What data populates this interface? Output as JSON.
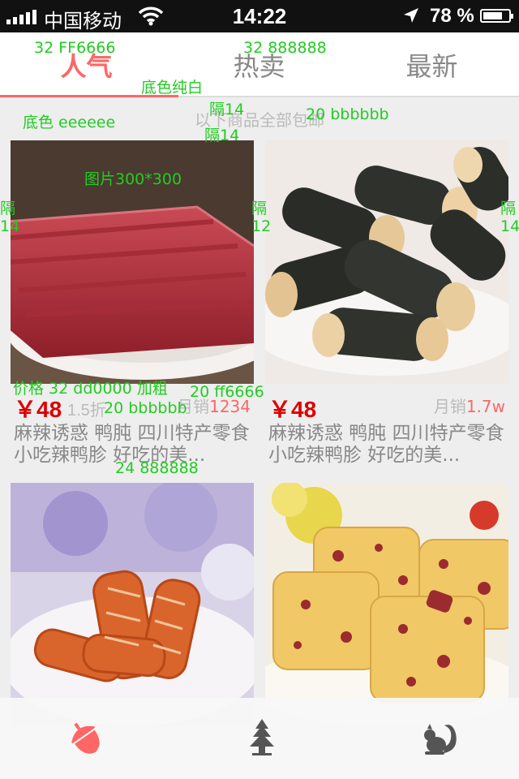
{
  "status": {
    "carrier": "中国移动",
    "time": "14:22",
    "battery": "78 %",
    "battery_level": 0.78
  },
  "tabs": [
    {
      "label": "人气",
      "active": true
    },
    {
      "label": "热卖",
      "active": false
    },
    {
      "label": "最新",
      "active": false
    }
  ],
  "notice": "以下商品全部包邮",
  "products": [
    {
      "price": "￥48",
      "discount": "1.5折",
      "sales_prefix": "月销",
      "sales_value": "1234",
      "title": "麻辣诱惑 鸭肫 四川特产零食小吃辣鸭胗 好吃的美..."
    },
    {
      "price": "￥48",
      "discount": "",
      "sales_prefix": "月销",
      "sales_value": "1.7w",
      "title": "麻辣诱惑 鸭肫 四川特产零食小吃辣鸭胗 好吃的美..."
    },
    {
      "price": "",
      "discount": "",
      "sales_prefix": "",
      "sales_value": "",
      "title": ""
    },
    {
      "price": "",
      "discount": "",
      "sales_prefix": "",
      "sales_value": "",
      "title": ""
    }
  ],
  "annotations": {
    "tab_active": "32 FF6666",
    "tab_inactive": "32 888888",
    "tab_bg": "底色纯白",
    "gap_top": "隔14",
    "page_bg": "底色 eeeeee",
    "notice_spec": "20 bbbbbb",
    "gap_bottom": "隔14",
    "image_spec": "图片300*300",
    "gap_left": "隔\n14",
    "gap_middle": "隔\n12",
    "gap_right": "隔\n14",
    "price_spec": "价格 32 dd0000 加粗",
    "sales_spec": "20 ff6666",
    "discount_spec": "20 bbbbbb",
    "title_spec": "24 888888"
  },
  "colors": {
    "accent": "#ff6666",
    "price": "#dd0000",
    "muted": "#bbbbbb",
    "text": "#888888",
    "bg": "#eeeeee"
  },
  "tabbar": {
    "icons": [
      "acorn-icon",
      "tree-icon",
      "squirrel-icon"
    ],
    "active_index": 0
  }
}
